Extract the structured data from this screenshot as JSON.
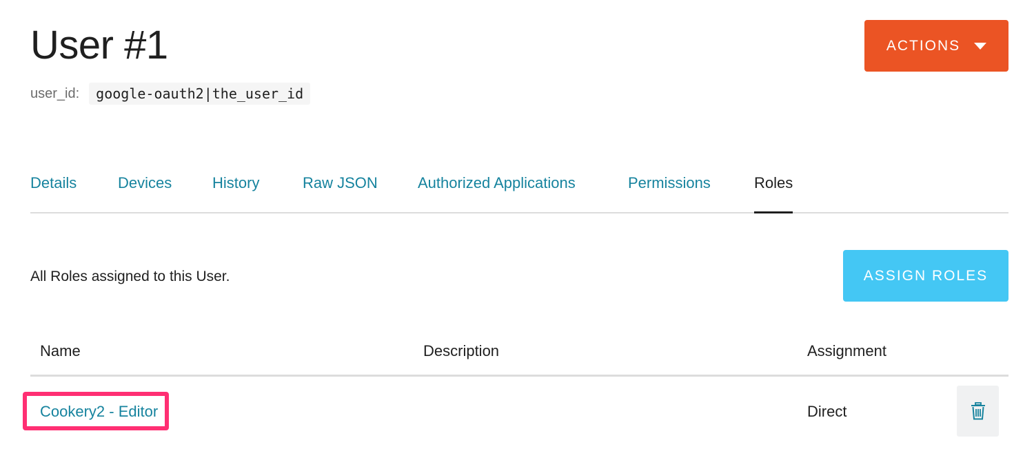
{
  "header": {
    "title": "User #1",
    "user_id_label": "user_id:",
    "user_id_value": "google-oauth2|the_user_id",
    "actions_label": "ACTIONS"
  },
  "tabs": [
    {
      "label": "Details",
      "active": false
    },
    {
      "label": "Devices",
      "active": false
    },
    {
      "label": "History",
      "active": false
    },
    {
      "label": "Raw JSON",
      "active": false
    },
    {
      "label": "Authorized Applications",
      "active": false
    },
    {
      "label": "Permissions",
      "active": false
    },
    {
      "label": "Roles",
      "active": true
    }
  ],
  "roles_section": {
    "intro": "All Roles assigned to this User.",
    "assign_label": "ASSIGN ROLES"
  },
  "table": {
    "columns": [
      "Name",
      "Description",
      "Assignment"
    ],
    "rows": [
      {
        "name": "Cookery2 - Editor",
        "description": "",
        "assignment": "Direct",
        "delete_icon": "trash-icon"
      }
    ]
  },
  "colors": {
    "accent_orange": "#eb5424",
    "accent_blue": "#44c7f4",
    "link": "#16839e",
    "highlight": "#ff2f73"
  }
}
